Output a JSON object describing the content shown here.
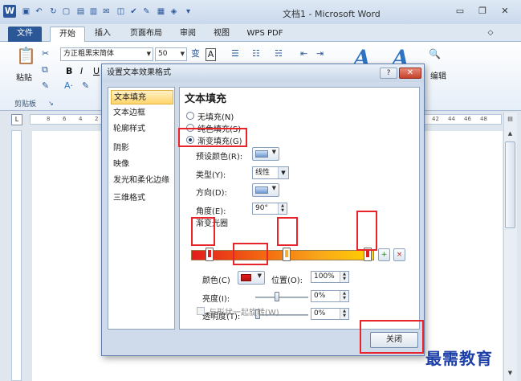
{
  "window": {
    "title": "文档1 - Microsoft Word",
    "minimize": "▭",
    "restore": "❐",
    "close": "✕"
  },
  "tabs": [
    {
      "label": "文件"
    },
    {
      "label": "开始"
    },
    {
      "label": "插入"
    },
    {
      "label": "页面布局"
    },
    {
      "label": "审阅"
    },
    {
      "label": "视图"
    },
    {
      "label": "WPS PDF"
    }
  ],
  "ribbon": {
    "paste_label": "粘贴",
    "clipboard_group": "剪贴板",
    "font_name": "方正粗黑宋简体",
    "font_size": "50",
    "edit_label": "编辑"
  },
  "ruler": {
    "left_ticks": [
      "8",
      "6",
      "4",
      "2"
    ],
    "right_ticks": [
      "42",
      "44",
      "46",
      "48"
    ]
  },
  "dialog": {
    "title": "设置文本效果格式",
    "help": "?",
    "close": "✕",
    "nav": [
      {
        "label": "文本填充"
      },
      {
        "label": "文本边框"
      },
      {
        "label": "轮廓样式"
      },
      {
        "label": "阴影"
      },
      {
        "label": "映像"
      },
      {
        "label": "发光和柔化边缘"
      },
      {
        "label": "三维格式"
      }
    ],
    "section_title": "文本填充",
    "options": {
      "no_fill": "无填充(N)",
      "solid_fill": "纯色填充(S)",
      "gradient_fill": "渐变填充(G)"
    },
    "preset_colors_label": "预设颜色(R):",
    "type_label": "类型(Y):",
    "type_value": "线性",
    "direction_label": "方向(D):",
    "angle_label": "角度(E):",
    "angle_value": "90°",
    "gradient_stops_label": "渐变光圈",
    "color_label": "颜色(C)",
    "position_label": "位置(O):",
    "position_value": "100%",
    "brightness_label": "亮度(I):",
    "brightness_value": "0%",
    "transparency_label": "透明度(T):",
    "transparency_value": "0%",
    "rotate_with_shape": "与形状一起旋转(W)",
    "close_button": "关闭",
    "gradient_colors": {
      "start": "#e41c1c",
      "mid": "#f36a10",
      "end": "#ffd200"
    }
  },
  "watermark": "最需教育",
  "highlight_color": "#e8232a"
}
